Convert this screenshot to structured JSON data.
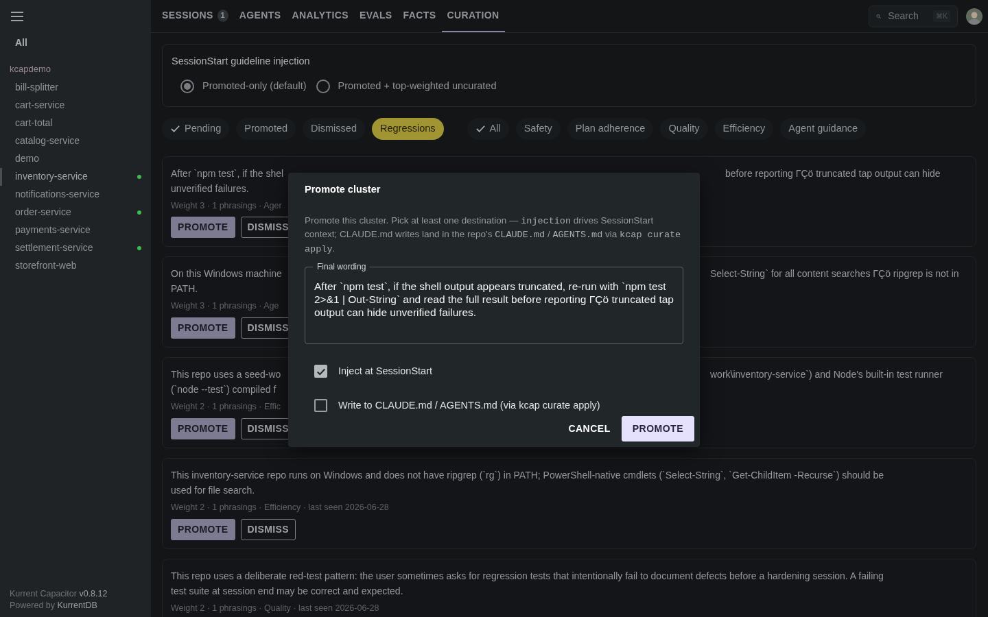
{
  "sidebar": {
    "all_link": {
      "label": "All"
    },
    "group": "kcapdemo",
    "items": [
      {
        "label": "bill-splitter",
        "selected": false,
        "live": false
      },
      {
        "label": "cart-service",
        "selected": false,
        "live": false
      },
      {
        "label": "cart-total",
        "selected": false,
        "live": false
      },
      {
        "label": "catalog-service",
        "selected": false,
        "live": false
      },
      {
        "label": "demo",
        "selected": false,
        "live": false
      },
      {
        "label": "inventory-service",
        "selected": true,
        "live": true
      },
      {
        "label": "notifications-service",
        "selected": false,
        "live": false
      },
      {
        "label": "order-service",
        "selected": false,
        "live": true
      },
      {
        "label": "payments-service",
        "selected": false,
        "live": false
      },
      {
        "label": "settlement-service",
        "selected": false,
        "live": true
      },
      {
        "label": "storefront-web",
        "selected": false,
        "live": false
      }
    ],
    "footer": [
      {
        "product": "Kurrent Capacitor",
        "version": "v0.8.12"
      },
      {
        "product": "Powered by",
        "version": "KurrentDB"
      }
    ]
  },
  "tabs": [
    {
      "label": "SESSIONS",
      "badge": "1",
      "selected": false
    },
    {
      "label": "AGENTS",
      "selected": false
    },
    {
      "label": "ANALYTICS",
      "selected": false
    },
    {
      "label": "EVALS",
      "selected": false
    },
    {
      "label": "FACTS",
      "selected": false
    },
    {
      "label": "CURATION",
      "selected": true
    }
  ],
  "search": {
    "placeholder": "Search",
    "shortcut": "⌘K"
  },
  "guideline": {
    "title": "SessionStart guideline injection",
    "options": [
      {
        "label": "Promoted-only (default)",
        "selected": true
      },
      {
        "label": "Promoted + top-weighted uncurated",
        "selected": false
      }
    ]
  },
  "status_filters": [
    {
      "label": "Pending",
      "checked": true,
      "highlighted": false
    },
    {
      "label": "Promoted",
      "checked": false,
      "highlighted": false
    },
    {
      "label": "Dismissed",
      "checked": false,
      "highlighted": false
    },
    {
      "label": "Regressions",
      "checked": false,
      "highlighted": true
    }
  ],
  "category_filters": [
    {
      "label": "All",
      "checked": true
    },
    {
      "label": "Safety",
      "checked": false
    },
    {
      "label": "Plan adherence",
      "checked": false
    },
    {
      "label": "Quality",
      "checked": false
    },
    {
      "label": "Efficiency",
      "checked": false
    },
    {
      "label": "Agent guidance",
      "checked": false
    }
  ],
  "clusters": [
    {
      "lines": [
        {
          "left": "After `npm test`, if the shel",
          "right": "before reporting ΓÇö truncated tap output can hide"
        },
        {
          "left": "unverified failures."
        }
      ],
      "meta": "Weight 3 · 1 phrasings · Ager",
      "buttons": [
        "PROMOTE",
        "DISMISS"
      ]
    },
    {
      "lines": [
        {
          "left": "On this Windows machine",
          "right": "Select-String` for all content searches ΓÇö ripgrep is not in"
        },
        {
          "left": "PATH."
        }
      ],
      "meta": "Weight 3 · 1 phrasings · Age",
      "buttons": [
        "PROMOTE",
        "DISMISS"
      ]
    },
    {
      "lines": [
        {
          "left": "This repo uses a seed-wo",
          "right": "work\\inventory-service`) and Node's built-in test runner"
        },
        {
          "left": "(`node --test`) compiled f"
        }
      ],
      "meta": "Weight 2 · 1 phrasings · Effic",
      "buttons": [
        "PROMOTE",
        "DISMISS"
      ]
    },
    {
      "lines": [
        {
          "left": "This inventory-service repo runs on Windows and does not have ripgrep (`rg`) in PATH; PowerShell-native cmdlets (`Select-String`, `Get-ChildItem -Recurse`) should be"
        },
        {
          "left": "used for file search."
        }
      ],
      "meta": "Weight 2 · 1 phrasings · Efficiency · last seen 2026-06-28",
      "buttons": [
        "PROMOTE",
        "DISMISS"
      ]
    },
    {
      "lines": [
        {
          "left": "This repo uses a deliberate red-test pattern: the user sometimes asks for regression tests that intentionally fail to document defects before a hardening session. A failing"
        },
        {
          "left": "test suite at session end may be correct and expected."
        }
      ],
      "meta": "Weight 2 · 1 phrasings · Quality · last seen 2026-06-28"
    }
  ],
  "dialog": {
    "title": "Promote cluster",
    "description": [
      {
        "kind": "text",
        "text": "Promote this cluster. Pick at least one destination — "
      },
      {
        "kind": "code",
        "text": "injection"
      },
      {
        "kind": "text",
        "text": " drives SessionStart context; CLAUDE.md writes land in the repo's "
      },
      {
        "kind": "code",
        "text": "CLAUDE.md"
      },
      {
        "kind": "text",
        "text": " / "
      },
      {
        "kind": "code",
        "text": "AGENTS.md"
      },
      {
        "kind": "text",
        "text": " via "
      },
      {
        "kind": "code",
        "text": "kcap curate apply"
      },
      {
        "kind": "text",
        "text": "."
      }
    ],
    "wording_label": "Final wording",
    "wording": "After `npm test`, if the shell output appears truncated, re-run with `npm test 2>&1 | Out-String` and read the full result before reporting ΓÇö truncated tap output can hide unverified failures.",
    "options": [
      {
        "label": "Inject at SessionStart",
        "checked": true
      },
      {
        "label": "Write to CLAUDE.md / AGENTS.md (via kcap curate apply)",
        "checked": false
      }
    ],
    "cancel": "CANCEL",
    "confirm": "PROMOTE"
  }
}
